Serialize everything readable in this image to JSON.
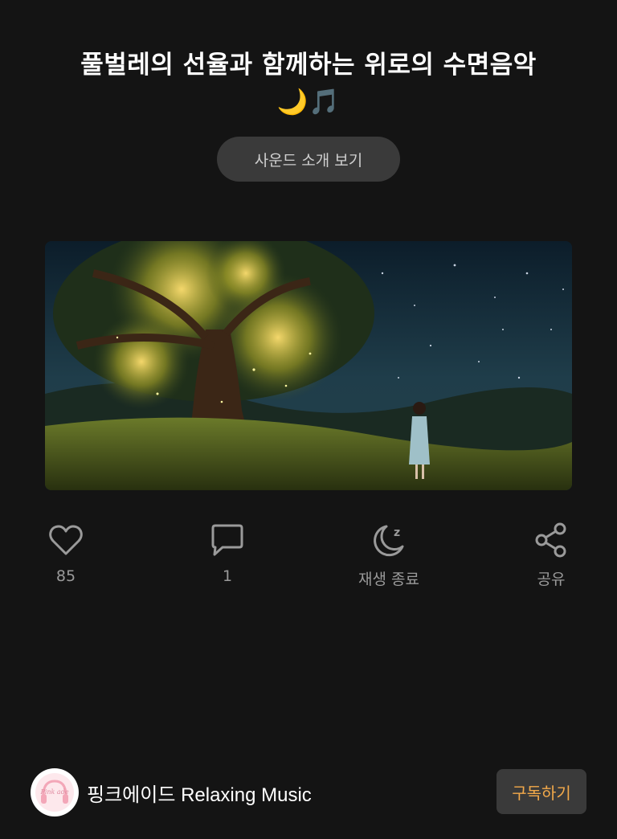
{
  "header": {
    "title": "풀벌레의 선율과 함께하는 위로의 수면음악",
    "title_emoji": "🌙🎵"
  },
  "intro_button": {
    "label": "사운드 소개 보기"
  },
  "actions": [
    {
      "icon": "heart-icon",
      "label": "85"
    },
    {
      "icon": "comment-icon",
      "label": "1"
    },
    {
      "icon": "sleep-timer-icon",
      "label": "재생 종료"
    },
    {
      "icon": "share-icon",
      "label": "공유"
    }
  ],
  "channel": {
    "name": "핑크에이드 Relaxing Music",
    "avatar_text": "Pink ade",
    "subscribe_label": "구독하기"
  },
  "colors": {
    "background": "#141414",
    "button": "#3a3a3a",
    "subscribe_text": "#f2a94a",
    "icon": "#9a9a9a"
  }
}
